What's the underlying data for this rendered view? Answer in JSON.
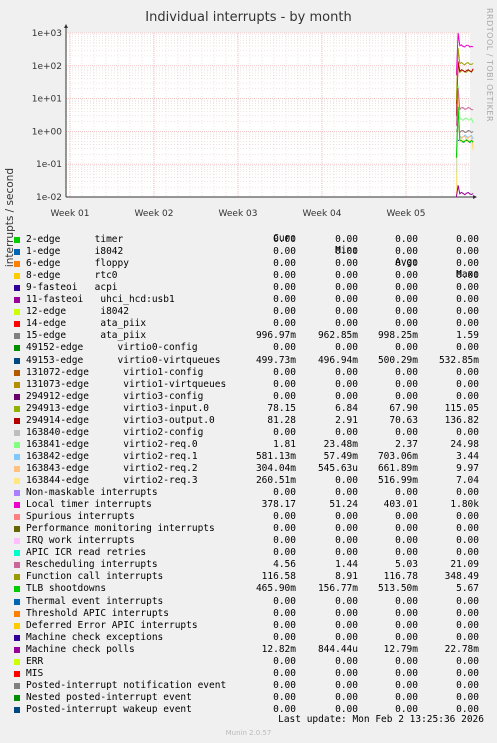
{
  "title": "Individual interrupts - by month",
  "side_label": "RRDTOOL / TOBI OETIKER",
  "last_update": "Last update: Mon Feb  2 13:25:36 2026",
  "footer": "Munin 2.0.57",
  "chart_data": {
    "type": "line",
    "title": "Individual interrupts - by month",
    "ylabel": "interrupts / second",
    "yscale": "log",
    "ylim": [
      0.01,
      1000
    ],
    "y_ticks": [
      "1e-02",
      "1e-01",
      "1e+00",
      "1e+01",
      "1e+02",
      "1e+03"
    ],
    "x_ticks": [
      "Week 01",
      "Week 02",
      "Week 03",
      "Week 04",
      "Week 05"
    ],
    "grid": true,
    "legend_placement": "bottom",
    "columns": [
      "Cur:",
      "Min:",
      "Avg:",
      "Max:"
    ],
    "series": [
      {
        "name": "2-edge      timer",
        "color": "#00cc00",
        "cur": "0.00",
        "min": "0.00",
        "avg": "0.00",
        "max": "0.00"
      },
      {
        "name": "1-edge      i8042",
        "color": "#0066b3",
        "cur": "0.00",
        "min": "0.00",
        "avg": "0.00",
        "max": "0.00"
      },
      {
        "name": "6-edge      floppy",
        "color": "#ff8000",
        "cur": "0.00",
        "min": "0.00",
        "avg": "0.00",
        "max": "0.00"
      },
      {
        "name": "8-edge      rtc0",
        "color": "#ffcc00",
        "cur": "0.00",
        "min": "0.00",
        "avg": "0.00",
        "max": "0.00"
      },
      {
        "name": "9-fasteoi   acpi",
        "color": "#330099",
        "cur": "0.00",
        "min": "0.00",
        "avg": "0.00",
        "max": "0.00"
      },
      {
        "name": "11-fasteoi   uhci_hcd:usb1",
        "color": "#990099",
        "cur": "0.00",
        "min": "0.00",
        "avg": "0.00",
        "max": "0.00"
      },
      {
        "name": "12-edge      i8042",
        "color": "#ccff00",
        "cur": "0.00",
        "min": "0.00",
        "avg": "0.00",
        "max": "0.00"
      },
      {
        "name": "14-edge      ata_piix",
        "color": "#ff0000",
        "cur": "0.00",
        "min": "0.00",
        "avg": "0.00",
        "max": "0.00"
      },
      {
        "name": "15-edge      ata_piix",
        "color": "#808080",
        "cur": "996.97m",
        "min": "962.85m",
        "avg": "998.25m",
        "max": "1.59"
      },
      {
        "name": "49152-edge      virtio0-config",
        "color": "#008f00",
        "cur": "0.00",
        "min": "0.00",
        "avg": "0.00",
        "max": "0.00"
      },
      {
        "name": "49153-edge      virtio0-virtqueues",
        "color": "#00487d",
        "cur": "499.73m",
        "min": "496.94m",
        "avg": "500.29m",
        "max": "532.85m"
      },
      {
        "name": "131072-edge      virtio1-config",
        "color": "#b35a00",
        "cur": "0.00",
        "min": "0.00",
        "avg": "0.00",
        "max": "0.00"
      },
      {
        "name": "131073-edge      virtio1-virtqueues",
        "color": "#b38f00",
        "cur": "0.00",
        "min": "0.00",
        "avg": "0.00",
        "max": "0.00"
      },
      {
        "name": "294912-edge      virtio3-config",
        "color": "#6b006b",
        "cur": "0.00",
        "min": "0.00",
        "avg": "0.00",
        "max": "0.00"
      },
      {
        "name": "294913-edge      virtio3-input.0",
        "color": "#8fb300",
        "cur": "78.15",
        "min": "6.84",
        "avg": "67.90",
        "max": "115.05"
      },
      {
        "name": "294914-edge      virtio3-output.0",
        "color": "#b30000",
        "cur": "81.28",
        "min": "2.91",
        "avg": "70.63",
        "max": "136.82"
      },
      {
        "name": "163840-edge      virtio2-config",
        "color": "#bebebe",
        "cur": "0.00",
        "min": "0.00",
        "avg": "0.00",
        "max": "0.00"
      },
      {
        "name": "163841-edge      virtio2-req.0",
        "color": "#80ff80",
        "cur": "1.81",
        "min": "23.48m",
        "avg": "2.37",
        "max": "24.98"
      },
      {
        "name": "163842-edge      virtio2-req.1",
        "color": "#80c9ff",
        "cur": "581.13m",
        "min": "57.49m",
        "avg": "703.06m",
        "max": "3.44"
      },
      {
        "name": "163843-edge      virtio2-req.2",
        "color": "#ffc080",
        "cur": "304.04m",
        "min": "545.63u",
        "avg": "661.89m",
        "max": "9.97"
      },
      {
        "name": "163844-edge      virtio2-req.3",
        "color": "#ffe680",
        "cur": "260.51m",
        "min": "0.00",
        "avg": "516.99m",
        "max": "7.04"
      },
      {
        "name": "Non-maskable interrupts",
        "color": "#aa80ff",
        "cur": "0.00",
        "min": "0.00",
        "avg": "0.00",
        "max": "0.00"
      },
      {
        "name": "Local timer interrupts",
        "color": "#ee00cc",
        "cur": "378.17",
        "min": "51.24",
        "avg": "403.01",
        "max": "1.80k"
      },
      {
        "name": "Spurious interrupts",
        "color": "#ff8080",
        "cur": "0.00",
        "min": "0.00",
        "avg": "0.00",
        "max": "0.00"
      },
      {
        "name": "Performance monitoring interrupts",
        "color": "#666600",
        "cur": "0.00",
        "min": "0.00",
        "avg": "0.00",
        "max": "0.00"
      },
      {
        "name": "IRQ work interrupts",
        "color": "#ffbfff",
        "cur": "0.00",
        "min": "0.00",
        "avg": "0.00",
        "max": "0.00"
      },
      {
        "name": "APIC ICR read retries",
        "color": "#00ffcc",
        "cur": "0.00",
        "min": "0.00",
        "avg": "0.00",
        "max": "0.00"
      },
      {
        "name": "Rescheduling interrupts",
        "color": "#cc6699",
        "cur": "4.56",
        "min": "1.44",
        "avg": "5.03",
        "max": "21.09"
      },
      {
        "name": "Function call interrupts",
        "color": "#999900",
        "cur": "116.58",
        "min": "8.91",
        "avg": "116.78",
        "max": "348.49"
      },
      {
        "name": "TLB shootdowns",
        "color": "#00cc00",
        "cur": "465.90m",
        "min": "156.77m",
        "avg": "513.50m",
        "max": "5.67"
      },
      {
        "name": "Thermal event interrupts",
        "color": "#0066b3",
        "cur": "0.00",
        "min": "0.00",
        "avg": "0.00",
        "max": "0.00"
      },
      {
        "name": "Threshold APIC interrupts",
        "color": "#ff8000",
        "cur": "0.00",
        "min": "0.00",
        "avg": "0.00",
        "max": "0.00"
      },
      {
        "name": "Deferred Error APIC interrupts",
        "color": "#ffcc00",
        "cur": "0.00",
        "min": "0.00",
        "avg": "0.00",
        "max": "0.00"
      },
      {
        "name": "Machine check exceptions",
        "color": "#330099",
        "cur": "0.00",
        "min": "0.00",
        "avg": "0.00",
        "max": "0.00"
      },
      {
        "name": "Machine check polls",
        "color": "#990099",
        "cur": "12.82m",
        "min": "844.44u",
        "avg": "12.79m",
        "max": "22.78m"
      },
      {
        "name": "ERR",
        "color": "#ccff00",
        "cur": "0.00",
        "min": "0.00",
        "avg": "0.00",
        "max": "0.00"
      },
      {
        "name": "MIS",
        "color": "#ff0000",
        "cur": "0.00",
        "min": "0.00",
        "avg": "0.00",
        "max": "0.00"
      },
      {
        "name": "Posted-interrupt notification event",
        "color": "#808080",
        "cur": "0.00",
        "min": "0.00",
        "avg": "0.00",
        "max": "0.00"
      },
      {
        "name": "Nested posted-interrupt event",
        "color": "#008f00",
        "cur": "0.00",
        "min": "0.00",
        "avg": "0.00",
        "max": "0.00"
      },
      {
        "name": "Posted-interrupt wakeup event",
        "color": "#00487d",
        "cur": "0.00",
        "min": "0.00",
        "avg": "0.00",
        "max": "0.00"
      }
    ]
  }
}
